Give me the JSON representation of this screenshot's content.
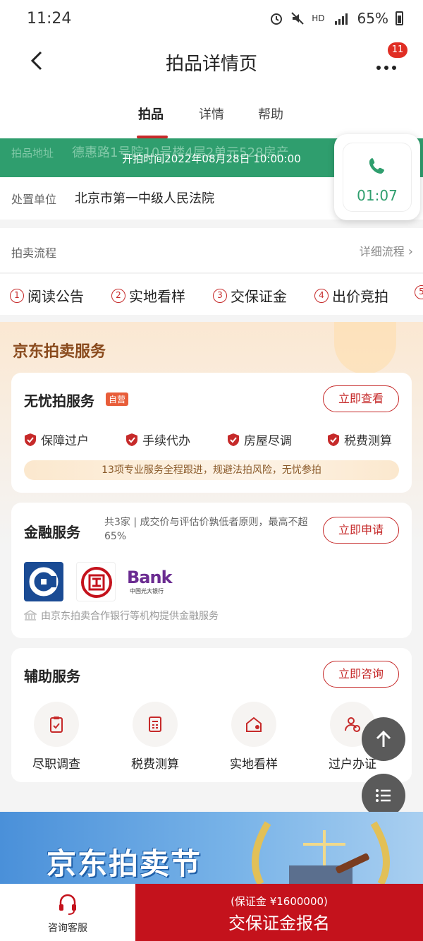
{
  "status_bar": {
    "time": "11:24",
    "network": "HD",
    "battery": "65%"
  },
  "nav": {
    "title": "拍品详情页",
    "badge_count": "11"
  },
  "tabs": [
    {
      "label": "拍品",
      "active": true
    },
    {
      "label": "详情",
      "active": false
    },
    {
      "label": "帮助",
      "active": false
    }
  ],
  "info": {
    "address_label": "拍品地址",
    "address_value": "德惠路1号院10号楼4层2单元528房产",
    "start_time": "开拍时间2022年08月28日 10:00:00",
    "org_label": "处置单位",
    "org_value": "北京市第一中级人民法院"
  },
  "call": {
    "timer": "01:07"
  },
  "process": {
    "label": "拍卖流程",
    "detail_link": "详细流程",
    "steps": [
      {
        "num": "1",
        "label": "阅读公告"
      },
      {
        "num": "2",
        "label": "实地看样"
      },
      {
        "num": "3",
        "label": "交保证金"
      },
      {
        "num": "4",
        "label": "出价竞拍"
      },
      {
        "num": "5",
        "label": ""
      }
    ]
  },
  "services": {
    "section_title": "京东拍卖服务",
    "worry_free": {
      "title": "无忧拍服务",
      "tag": "自营",
      "button": "立即查看",
      "features": [
        "保障过户",
        "手续代办",
        "房屋尽调",
        "税费测算"
      ],
      "promise": "13项专业服务全程跟进，规避法拍风险，无忧参拍"
    },
    "finance": {
      "title": "金融服务",
      "note": "共3家 | 成交价与评估价孰低者原则，最高不超65%",
      "button": "立即申请",
      "footer": "由京东拍卖合作银行等机构提供金融服务",
      "bank3_text": "Bank",
      "bank3_sub": "中国光大银行"
    },
    "auxiliary": {
      "title": "辅助服务",
      "button": "立即咨询",
      "items": [
        {
          "label": "尽职调查",
          "icon": "clipboard-check-icon"
        },
        {
          "label": "税费测算",
          "icon": "calculator-icon"
        },
        {
          "label": "实地看样",
          "icon": "house-location-icon"
        },
        {
          "label": "过户办证",
          "icon": "user-transfer-icon"
        }
      ]
    }
  },
  "banner": {
    "text": "京东拍卖节"
  },
  "bottom": {
    "service_label": "咨询客服",
    "deposit_note": "(保证金 ¥1600000)",
    "cta_label": "交保证金报名"
  },
  "colors": {
    "brand_red": "#c4121c",
    "green": "#2f9e6e",
    "gold_text": "#8a4b1e"
  }
}
